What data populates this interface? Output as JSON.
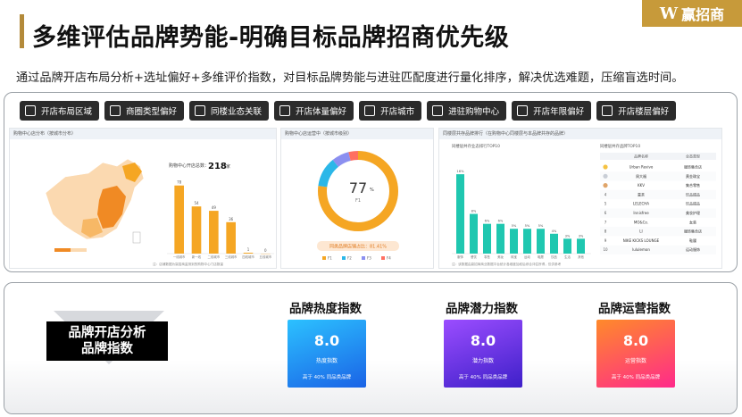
{
  "header": {
    "title": "多维评估品牌势能-明确目标品牌招商优先级",
    "logo_text": "赢招商",
    "subtitle": "通过品牌开店布局分析+选址偏好+多维评价指数，对目标品牌势能与进驻匹配度进行量化排序，解决优选难题，压缩盲选时间。"
  },
  "toolbar": [
    {
      "label": "开店布局区域",
      "icon": "map-pin-icon"
    },
    {
      "label": "商圈类型偏好",
      "icon": "grid-icon"
    },
    {
      "label": "同楼业态关联",
      "icon": "link-icon"
    },
    {
      "label": "开店体量偏好",
      "icon": "building-icon"
    },
    {
      "label": "开店城市",
      "icon": "city-icon"
    },
    {
      "label": "进驻购物中心",
      "icon": "mall-icon"
    },
    {
      "label": "开店年限偏好",
      "icon": "calendar-icon"
    },
    {
      "label": "开店楼层偏好",
      "icon": "floor-icon"
    }
  ],
  "card_map": {
    "header": "购物中心店分布（按城市分布）",
    "total_label": "购物中心开店总数：",
    "total_value": "218",
    "total_unit": "家",
    "footnote": "注：店铺数据为赢招商监测到的购物中心门店数量"
  },
  "card_donut": {
    "header": "购物中心店运营中（按城市级别）",
    "center_value": "77",
    "center_unit": "%",
    "center_sub": "F1",
    "note": "同类品牌店铺占比：81.41%",
    "legend": [
      "F1",
      "F2",
      "F3",
      "F4"
    ]
  },
  "card_rank": {
    "header": "同楼层共存品牌排行（在购物中心同楼层与本品牌共存的品牌）",
    "left_title": "同楼层共存业态排行TOP10",
    "right_title": "同楼层共存品牌TOP10",
    "col_brand": "品牌名称",
    "col_type": "业态类型",
    "brands": [
      {
        "rank": "1",
        "name": "Urban Revivo",
        "type": "服饰集合店"
      },
      {
        "rank": "2",
        "name": "周大福",
        "type": "黄金珠宝"
      },
      {
        "rank": "3",
        "name": "KKV",
        "type": "集合零售"
      },
      {
        "rank": "4",
        "name": "喜茶",
        "type": "饮品甜品"
      },
      {
        "rank": "5",
        "name": "LELECHA",
        "type": "饮品甜品"
      },
      {
        "rank": "6",
        "name": "Innisfree",
        "type": "美妆护理"
      },
      {
        "rank": "7",
        "name": "MO&Co.",
        "type": "女装"
      },
      {
        "rank": "8",
        "name": "LI",
        "type": "服饰集合店"
      },
      {
        "rank": "9",
        "name": "NIKE KICKS LOUNGE",
        "type": "鞋履"
      },
      {
        "rank": "10",
        "name": "lululemon",
        "type": "运动服饰"
      }
    ],
    "footnote": "注：该数据由赢招商商业数据平台统计各维度加权后综合评估所得，仅供参考"
  },
  "chart_data": [
    {
      "type": "bar",
      "categories": [
        "一线城市",
        "新一线",
        "二线城市",
        "三线城市",
        "四线城市",
        "五线城市"
      ],
      "values": [
        78,
        54,
        49,
        36,
        1,
        0
      ],
      "ylim": [
        0,
        90
      ],
      "color": "#f5a623",
      "title": "",
      "xlabel": "",
      "ylabel": ""
    },
    {
      "type": "pie",
      "categories": [
        "F1",
        "F2",
        "F3",
        "F4"
      ],
      "values": [
        77,
        12,
        7,
        4
      ],
      "colors": [
        "#f5a623",
        "#2bb7e8",
        "#8b8ff0",
        "#ff6f61"
      ],
      "title": ""
    },
    {
      "type": "bar",
      "categories": [
        "服饰",
        "餐饮",
        "零售",
        "美妆",
        "珠宝",
        "运动",
        "鞋履",
        "饮品",
        "生活",
        "其他"
      ],
      "values": [
        16,
        8,
        6,
        6,
        5,
        5,
        5,
        4,
        3,
        3
      ],
      "ylim": [
        0,
        18
      ],
      "color": "#1fc7b0",
      "title": "",
      "xlabel": "",
      "ylabel": ""
    }
  ],
  "bottom": {
    "center_title_line1": "品牌开店分析",
    "center_title_line2": "品牌指数",
    "indices": [
      {
        "title": "品牌热度指数",
        "value": "8.0",
        "label": "热度指数",
        "foot": "高于 40% 同品类品牌"
      },
      {
        "title": "品牌潜力指数",
        "value": "8.0",
        "label": "潜力指数",
        "foot": "高于 40% 同品类品牌"
      },
      {
        "title": "品牌运营指数",
        "value": "8.0",
        "label": "运营指数",
        "foot": "高于 40% 同品类品牌"
      }
    ]
  }
}
